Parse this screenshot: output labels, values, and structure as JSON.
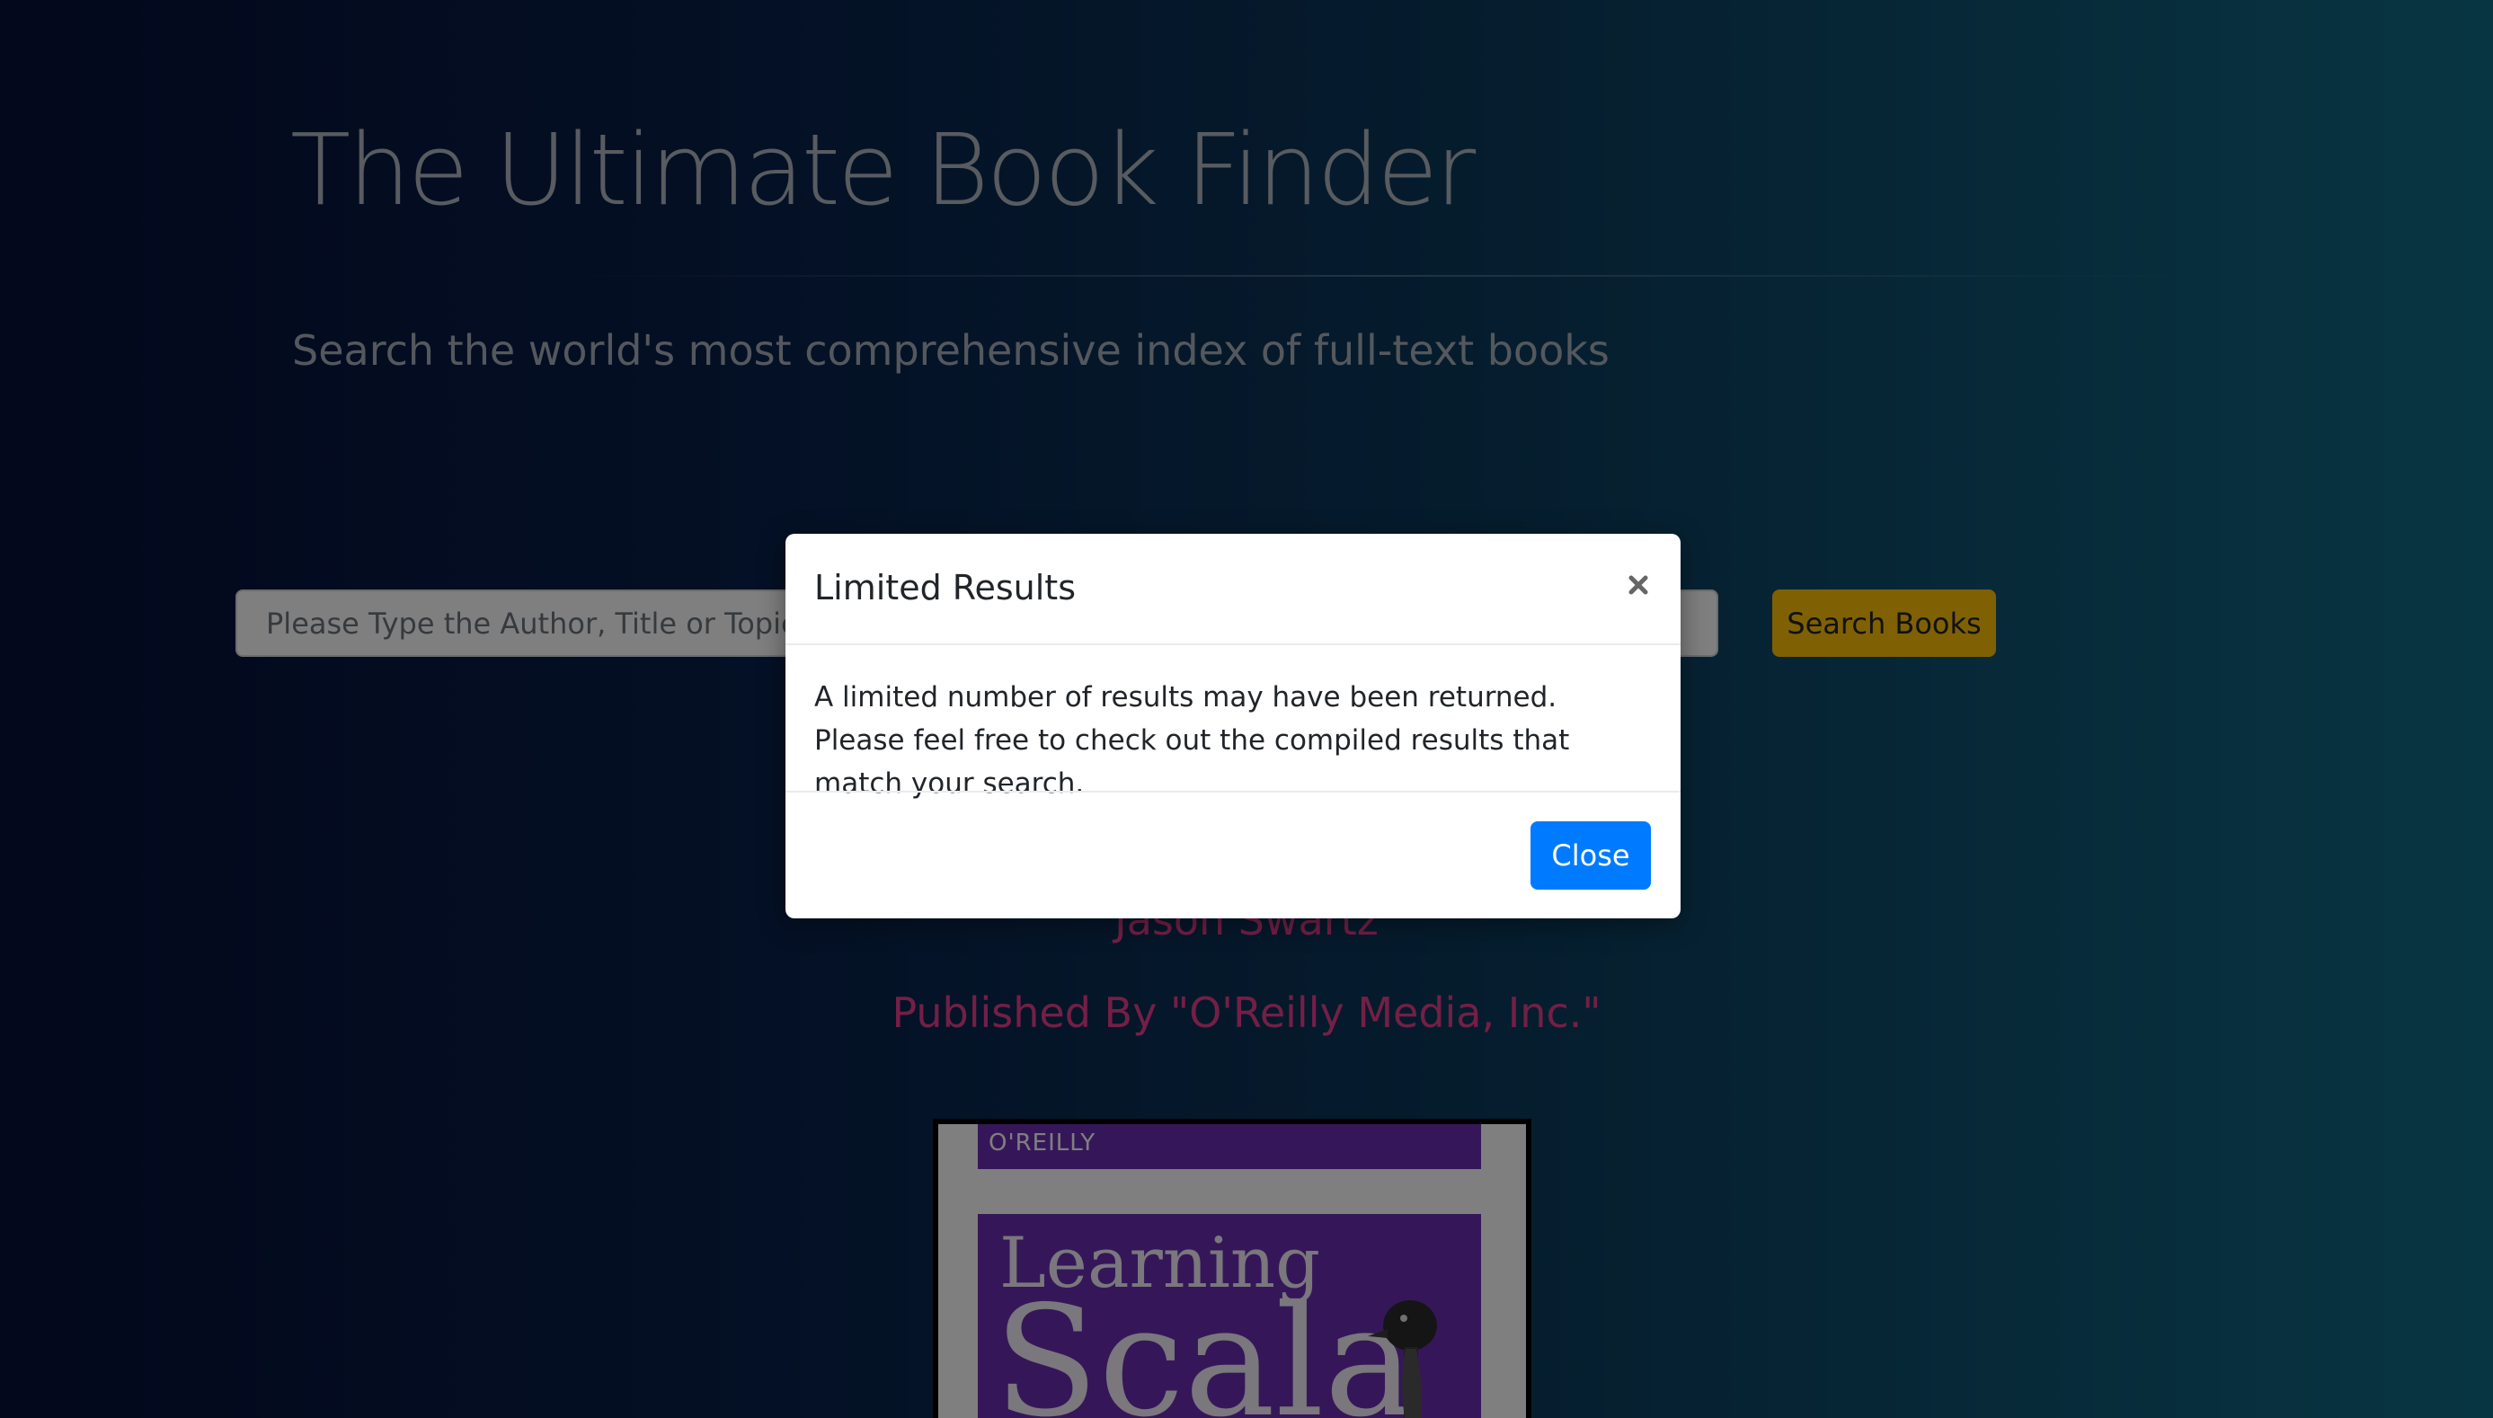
{
  "header": {
    "title": "The Ultimate Book Finder",
    "subtitle": "Search the world's most comprehensive index of full-text books"
  },
  "search": {
    "placeholder": "Please Type the Author, Title or Topic",
    "button_label": "Search Books"
  },
  "result": {
    "title": "",
    "author": "Jason Swartz",
    "publisher": "Published By \"O'Reilly Media, Inc.\"",
    "cover": {
      "publisher_mark": "O'REILLY",
      "title_line1": "Learning",
      "title_line2": "Scala"
    }
  },
  "modal": {
    "title": "Limited Results",
    "body": "A limited number of results may have been returned. Please feel free to check out the compiled results that match your search.",
    "close_button_label": "Close",
    "close_icon": "close-icon"
  },
  "colors": {
    "accent_warning": "#ffc107",
    "accent_primary": "#007bff",
    "result_text": "#e83e8c"
  }
}
